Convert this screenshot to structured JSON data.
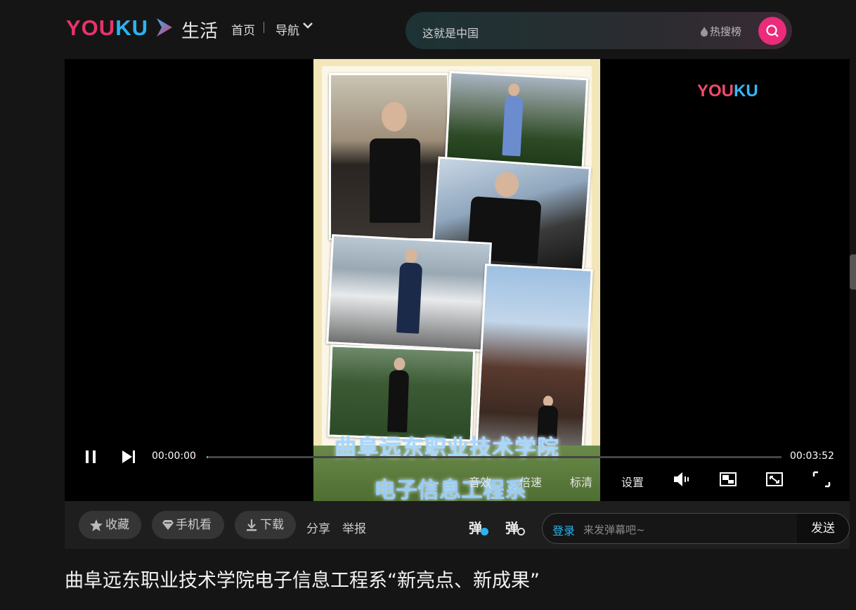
{
  "header": {
    "logo": {
      "part1": "YOU",
      "part2": "KU"
    },
    "channel": "生活",
    "nav": {
      "home": "首页",
      "guide": "导航"
    },
    "search": {
      "value": "这就是中国",
      "hot_label": "热搜榜"
    }
  },
  "player": {
    "watermark": {
      "part1": "YOU",
      "part2": "KU"
    },
    "overlay_title": "曲阜远东职业技术学院",
    "overlay_subtitle": "电子信息工程系",
    "time_current": "00:00:00",
    "time_total": "00:03:52",
    "progress": 0.002,
    "options": {
      "sound_effect": "音效",
      "speed": "倍速",
      "quality": "标清",
      "settings": "设置"
    }
  },
  "actions": {
    "favorite": "收藏",
    "mobile": "手机看",
    "download": "下载",
    "share": "分享",
    "report": "举报",
    "danmaku_char": "弹",
    "danmaku": {
      "login": "登录",
      "placeholder": "来发弹幕吧~",
      "send": "发送"
    }
  },
  "video_title": "曲阜远东职业技术学院电子信息工程系“新亮点、新成果”",
  "colors": {
    "brand_pink": "#e8336a",
    "brand_blue": "#2ab3f3",
    "search_btn": "#ec2b7b"
  }
}
